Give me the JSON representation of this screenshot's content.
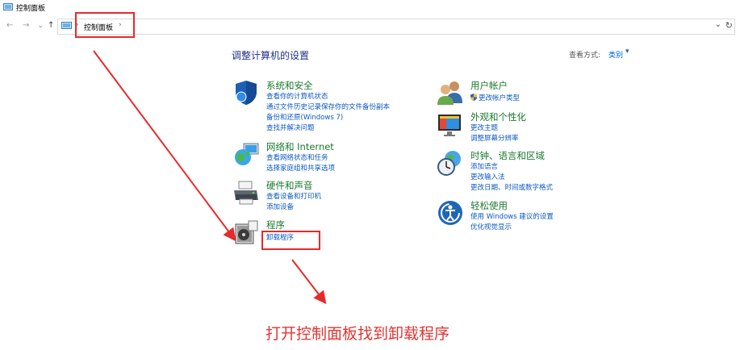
{
  "window": {
    "title": "控制面板"
  },
  "nav": {
    "back": "←",
    "forward": "→",
    "recent": "⌄",
    "up": "↑",
    "breadcrumb": "控制面板",
    "sep": "›",
    "dropdown": "⌄",
    "refresh": "↻"
  },
  "content": {
    "heading": "调整计算机的设置",
    "view_by_label": "查看方式:",
    "view_by_value": "类别",
    "view_by_caret": "▾"
  },
  "categories": [
    {
      "title": "系统和安全",
      "icon": "shield-icon",
      "links": [
        "查看你的计算机状态",
        "通过文件历史记录保存你的文件备份副本",
        "备份和还原(Windows 7)",
        "查找并解决问题"
      ]
    },
    {
      "title": "网络和 Internet",
      "icon": "globe-icon",
      "links": [
        "查看网络状态和任务",
        "选择家庭组和共享选项"
      ]
    },
    {
      "title": "硬件和声音",
      "icon": "printer-icon",
      "links": [
        "查看设备和打印机",
        "添加设备"
      ]
    },
    {
      "title": "程序",
      "icon": "programs-icon",
      "links": [
        "卸载程序"
      ]
    },
    {
      "title": "用户帐户",
      "icon": "users-icon",
      "links": [
        "更改帐户类型"
      ]
    },
    {
      "title": "外观和个性化",
      "icon": "monitor-icon",
      "links": [
        "更改主题",
        "调整屏幕分辨率"
      ]
    },
    {
      "title": "时钟、语言和区域",
      "icon": "clock-globe-icon",
      "links": [
        "添加语言",
        "更改输入法",
        "更改日期、时间或数字格式"
      ]
    },
    {
      "title": "轻松使用",
      "icon": "ease-of-access-icon",
      "links": [
        "使用 Windows 建议的设置",
        "优化视觉显示"
      ]
    }
  ],
  "annotation": {
    "caption": "打开控制面板找到卸载程序",
    "color": "#e8292c"
  }
}
